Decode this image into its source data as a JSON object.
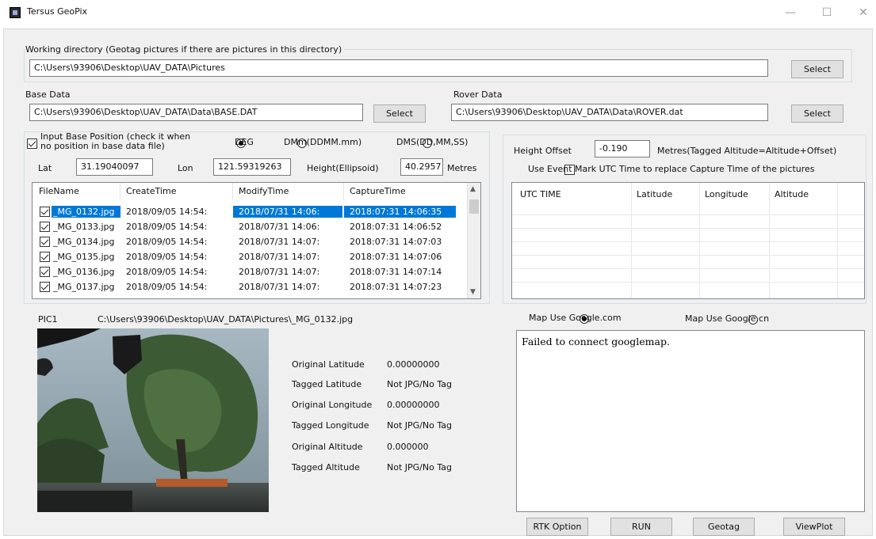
{
  "window": {
    "title": "Tersus GeoPix",
    "minimize": "—",
    "maximize": "☐",
    "close": "✕"
  },
  "working_dir": {
    "label": "Working directory (Geotag pictures if there are pictures in this directory)",
    "value": "C:\\Users\\93906\\Desktop\\UAV_DATA\\Pictures",
    "select": "Select"
  },
  "base_data": {
    "label": "Base Data",
    "value": "C:\\Users\\93906\\Desktop\\UAV_DATA\\Data\\BASE.DAT",
    "select": "Select"
  },
  "rover_data": {
    "label": "Rover Data",
    "value": "C:\\Users\\93906\\Desktop\\UAV_DATA\\Data\\ROVER.dat",
    "select": "Select"
  },
  "base_position": {
    "checkbox_label_1": "Input Base Position (check it when",
    "checkbox_label_2": "no position in base data file)",
    "checked": true,
    "formats": [
      "DEG",
      "DMm(DDMM.mm)",
      "DMS(DD,MM,SS)"
    ],
    "selected_format": "DEG",
    "lat_label": "Lat",
    "lat_value": "31.19040097",
    "lon_label": "Lon",
    "lon_value": "121.59319263",
    "height_label": "Height(Ellipsoid)",
    "height_value": "40.2957",
    "height_unit": "Metres"
  },
  "file_list": {
    "columns": [
      "FileName",
      "CreateTime",
      "ModifyTime",
      "CaptureTime"
    ],
    "rows": [
      {
        "name": "_MG_0132.jpg",
        "create": "2018/09/05 14:54:",
        "modify": "2018/07/31 14:06:",
        "capture": "2018:07:31 14:06:35",
        "selected": true
      },
      {
        "name": "_MG_0133.jpg",
        "create": "2018/09/05 14:54:",
        "modify": "2018/07/31 14:06:",
        "capture": "2018:07:31 14:06:52",
        "selected": false
      },
      {
        "name": "_MG_0134.jpg",
        "create": "2018/09/05 14:54:",
        "modify": "2018/07/31 14:07:",
        "capture": "2018:07:31 14:07:03",
        "selected": false
      },
      {
        "name": "_MG_0135.jpg",
        "create": "2018/09/05 14:54:",
        "modify": "2018/07/31 14:07:",
        "capture": "2018:07:31 14:07:06",
        "selected": false
      },
      {
        "name": "_MG_0136.jpg",
        "create": "2018/09/05 14:54:",
        "modify": "2018/07/31 14:07:",
        "capture": "2018:07:31 14:07:14",
        "selected": false
      },
      {
        "name": "_MG_0137.jpg",
        "create": "2018/09/05 14:54:",
        "modify": "2018/07/31 14:07:",
        "capture": "2018:07:31 14:07:23",
        "selected": false
      }
    ]
  },
  "height_offset": {
    "label": "Height Offset",
    "value": "-0.190",
    "note": "Metres(Tagged Altitude=Altitude+Offset)"
  },
  "event_mark": {
    "label": "Use Event Mark UTC Time to replace Capture Time of the pictures",
    "checked": false
  },
  "event_table": {
    "columns": [
      "UTC TIME",
      "Latitude",
      "Longitude",
      "Altitude"
    ]
  },
  "picture": {
    "label": "PIC1",
    "path": "C:\\Users\\93906\\Desktop\\UAV_DATA\\Pictures\\_MG_0132.jpg"
  },
  "picture_info": [
    {
      "label": "Original Latitude",
      "value": "0.00000000"
    },
    {
      "label": "Tagged Latitude",
      "value": "Not JPG/No Tag"
    },
    {
      "label": "Original Longitude",
      "value": "0.00000000"
    },
    {
      "label": "Tagged Longitude",
      "value": "Not JPG/No Tag"
    },
    {
      "label": "Original Altitude",
      "value": "0.000000"
    },
    {
      "label": "Tagged Altitude",
      "value": "Not JPG/No Tag"
    }
  ],
  "map": {
    "option_com": "Map Use Google.com",
    "option_cn": "Map Use Google.cn",
    "selected": "Map Use Google.com",
    "message": "Failed to connect googlemap."
  },
  "actions": {
    "rtk": "RTK Option",
    "run": "RUN",
    "geotag": "Geotag",
    "viewplot": "ViewPlot"
  }
}
